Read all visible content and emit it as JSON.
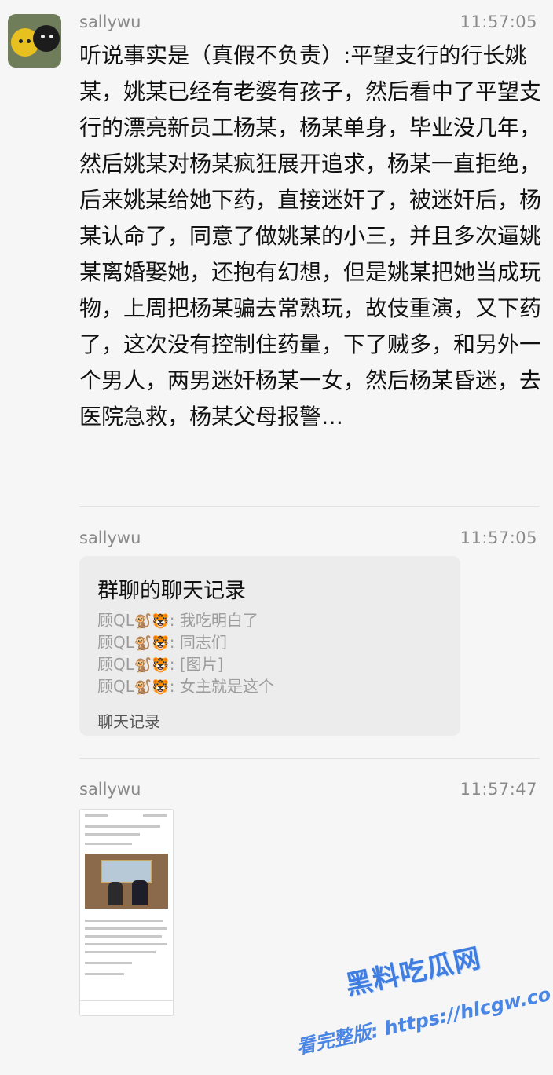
{
  "messages": [
    {
      "sender": "sallywu",
      "time": "11:57:05",
      "text": "听说事实是（真假不负责）:平望支行的行长姚某，姚某已经有老婆有孩子，然后看中了平望支行的漂亮新员工杨某，杨某单身，毕业没几年，然后姚某对杨某疯狂展开追求，杨某一直拒绝，后来姚某给她下药，直接迷奸了，被迷奸后，杨某认命了，同意了做姚某的小三，并且多次逼姚某离婚娶她，还抱有幻想，但是姚某把她当成玩物，上周把杨某骗去常熟玩，故伎重演，又下药了，这次没有控制住药量，下了贼多，和另外一个男人，两男迷奸杨某一女，然后杨某昏迷，去医院急救，杨某父母报警…"
    },
    {
      "sender": "sallywu",
      "time": "11:57:05",
      "card": {
        "title": "群聊的聊天记录",
        "lines": [
          {
            "name": "顾QL",
            "emoji": "🐒🐯",
            "text": ": 我吃明白了"
          },
          {
            "name": "顾QL",
            "emoji": "🐒🐯",
            "text": ": 同志们"
          },
          {
            "name": "顾QL",
            "emoji": "🐒🐯",
            "text": ": [图片]"
          },
          {
            "name": "顾QL",
            "emoji": "🐒🐯",
            "text": ": 女主就是这个"
          }
        ],
        "footer": "聊天记录"
      }
    },
    {
      "sender": "sallywu",
      "time": "11:57:47",
      "attachment": "image-thumbnail"
    }
  ],
  "watermark": {
    "title": "黑料吃瓜网",
    "subtitle": "看完整版: https://hlcgw.co"
  },
  "colors": {
    "background": "#f6f6f6",
    "card": "#ececec",
    "meta": "#8a8a8a",
    "watermark": "#3f7de0"
  }
}
